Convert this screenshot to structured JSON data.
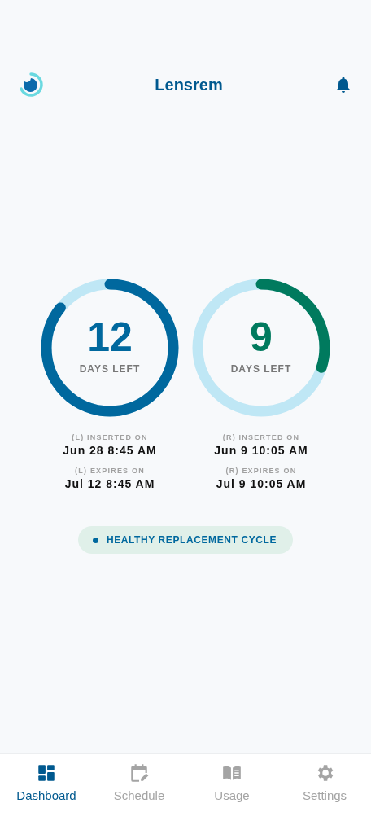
{
  "header": {
    "title": "Lensrem"
  },
  "lenses": [
    {
      "days": "12",
      "days_label": "DAYS LEFT",
      "level": 0.857,
      "color": "#00689e",
      "inserted_label": "(L) INSERTED ON",
      "inserted": "Jun 28 8:45 AM",
      "expires_label": "(L) EXPIRES ON",
      "expires": "Jul 12 8:45 AM"
    },
    {
      "days": "9",
      "days_label": "DAYS LEFT",
      "level": 0.3,
      "color": "#007a5e",
      "inserted_label": "(R) INSERTED ON",
      "inserted": "Jun 9 10:05 AM",
      "expires_label": "(R) EXPIRES ON",
      "expires": "Jul 9 10:05 AM"
    }
  ],
  "status": {
    "label": "HEALTHY REPLACEMENT CYCLE",
    "color": "#00689e"
  },
  "nav": [
    {
      "kind": "dashboard",
      "label": "Dashboard",
      "selected": true
    },
    {
      "kind": "schedule",
      "label": "Schedule",
      "selected": false
    },
    {
      "kind": "usage",
      "label": "Usage",
      "selected": false
    },
    {
      "kind": "settings",
      "label": "Settings",
      "selected": false
    }
  ]
}
